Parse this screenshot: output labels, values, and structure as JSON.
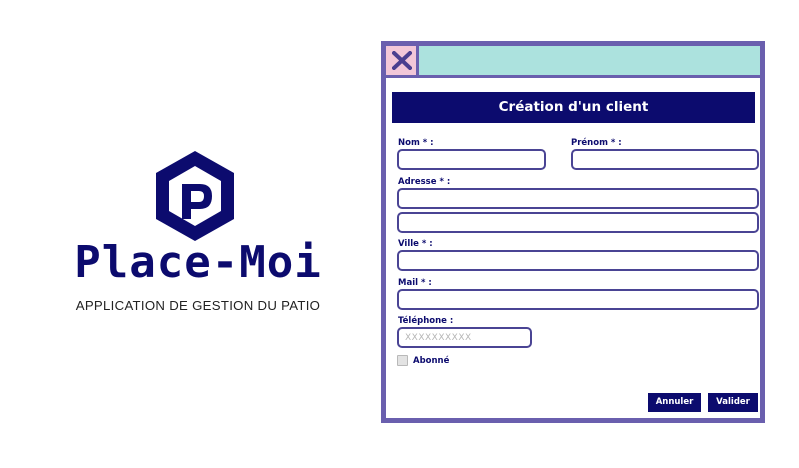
{
  "brand": {
    "name": "Place-Moi",
    "tagline": "APPLICATION DE GESTION DU PATIO",
    "logo_icon": "hexagon-p-logo",
    "color": "#0c0b6e"
  },
  "dialog": {
    "close_icon": "close-x-icon",
    "title": "Création d'un client",
    "colors": {
      "frame": "#6a5fae",
      "titlebar": "#ace2de",
      "close_button": "#f2c7d8",
      "accent": "#0c0b6e"
    },
    "fields": {
      "nom": {
        "label": "Nom * :",
        "value": ""
      },
      "prenom": {
        "label": "Prénom * :",
        "value": ""
      },
      "adresse": {
        "label": "Adresse * :",
        "line1": "",
        "line2": ""
      },
      "ville": {
        "label": "Ville * :",
        "value": ""
      },
      "mail": {
        "label": "Mail * :",
        "value": ""
      },
      "telephone": {
        "label": "Téléphone :",
        "value": "",
        "placeholder": "XXXXXXXXXX"
      }
    },
    "abonne": {
      "label": "Abonné",
      "checked": false
    },
    "buttons": {
      "cancel": "Annuler",
      "submit": "Valider"
    }
  }
}
